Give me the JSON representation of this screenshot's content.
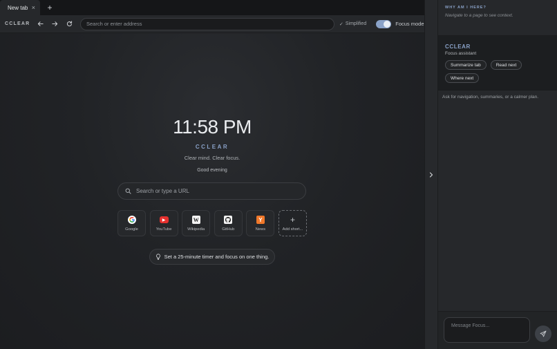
{
  "tabs": [
    {
      "label": "New tab",
      "close": "×"
    }
  ],
  "new_tab_icon": "+",
  "toolbar": {
    "brand": "CCLEAR",
    "address_placeholder": "Search or enter address",
    "simplified_check": "✓",
    "simplified_label": "Simplified",
    "focus_mode_label": "Focus mode",
    "focus_mode_on": true
  },
  "ntp": {
    "clock": "11:58 PM",
    "brand": "CCLEAR",
    "tagline": "Clear mind. Clear focus.",
    "greeting": "Good evening",
    "search_placeholder": "Search or type a URL",
    "shortcuts": [
      {
        "label": "Google",
        "icon": "google-icon",
        "glyph": "G"
      },
      {
        "label": "YouTube",
        "icon": "youtube-icon",
        "glyph": "▶"
      },
      {
        "label": "Wikipedia",
        "icon": "wikipedia-icon",
        "glyph": "W"
      },
      {
        "label": "GitHub",
        "icon": "github-icon",
        "glyph": ""
      },
      {
        "label": "News",
        "icon": "hacker-news-icon",
        "glyph": "Y"
      },
      {
        "label": "Add short...",
        "icon": "plus-icon",
        "glyph": "+"
      }
    ],
    "tip": "Set a 25-minute timer and focus on one thing."
  },
  "panel": {
    "why_title": "WHY AM I HERE?",
    "why_text": "Navigate to a page to see context.",
    "assistant_name": "CCLEAR",
    "assistant_sub": "Focus assistant",
    "chips": [
      "Summarize tab",
      "Read next",
      "Where next"
    ],
    "hint": "Ask for navigation, summaries, or a calmer plan.",
    "composer_placeholder": "Message Focus..."
  },
  "colors": {
    "accent": "#8aa2c8",
    "youtube": "#e5312f",
    "hn": "#f0782a"
  }
}
